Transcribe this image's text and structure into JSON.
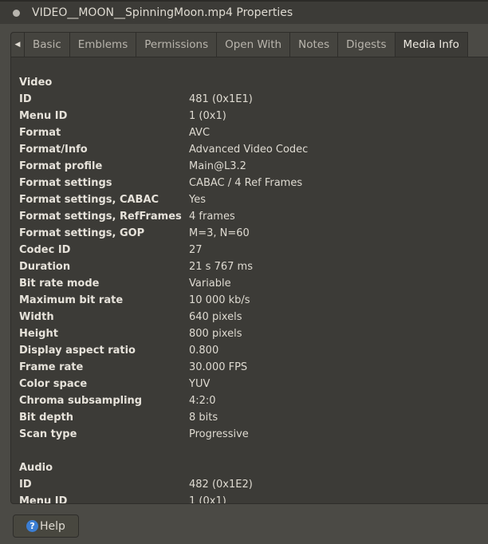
{
  "window": {
    "title": "VIDEO__MOON__SpinningMoon.mp4 Properties"
  },
  "tabs": [
    "Basic",
    "Emblems",
    "Permissions",
    "Open With",
    "Notes",
    "Digests",
    "Media Info"
  ],
  "active_tab": "Media Info",
  "media_info": [
    {
      "label": "Video",
      "value": "",
      "heading": true
    },
    {
      "label": "ID",
      "value": "481 (0x1E1)"
    },
    {
      "label": "Menu ID",
      "value": "1 (0x1)"
    },
    {
      "label": "Format",
      "value": "AVC"
    },
    {
      "label": "Format/Info",
      "value": "Advanced Video Codec"
    },
    {
      "label": "Format profile",
      "value": "Main@L3.2"
    },
    {
      "label": "Format settings",
      "value": "CABAC / 4 Ref Frames"
    },
    {
      "label": "Format settings, CABAC",
      "value": "Yes"
    },
    {
      "label": "Format settings, RefFrames",
      "value": "4 frames"
    },
    {
      "label": "Format settings, GOP",
      "value": "M=3, N=60"
    },
    {
      "label": "Codec ID",
      "value": "27"
    },
    {
      "label": "Duration",
      "value": "21 s 767 ms"
    },
    {
      "label": "Bit rate mode",
      "value": "Variable"
    },
    {
      "label": "Maximum bit rate",
      "value": "10 000 kb/s"
    },
    {
      "label": "Width",
      "value": "640 pixels"
    },
    {
      "label": "Height",
      "value": "800 pixels"
    },
    {
      "label": "Display aspect ratio",
      "value": "0.800"
    },
    {
      "label": "Frame rate",
      "value": "30.000 FPS"
    },
    {
      "label": "Color space",
      "value": "YUV"
    },
    {
      "label": "Chroma subsampling",
      "value": "4:2:0"
    },
    {
      "label": "Bit depth",
      "value": "8 bits"
    },
    {
      "label": "Scan type",
      "value": "Progressive"
    },
    {
      "label": "",
      "value": ""
    },
    {
      "label": "Audio",
      "value": "",
      "heading": true
    },
    {
      "label": "ID",
      "value": "482 (0x1E2)"
    },
    {
      "label": "Menu ID",
      "value": "1 (0x1)"
    }
  ],
  "help": {
    "label": "Help",
    "icon": "help-icon"
  }
}
